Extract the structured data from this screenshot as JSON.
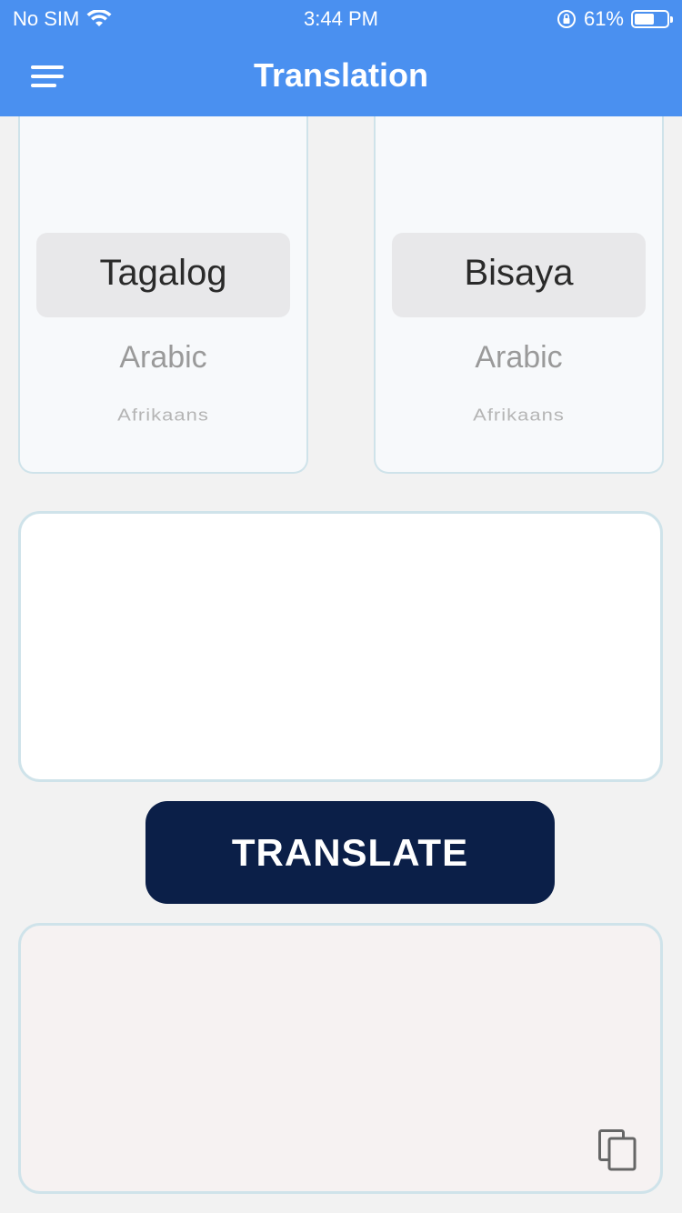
{
  "status_bar": {
    "carrier": "No SIM",
    "time": "3:44 PM",
    "battery_percent": "61%",
    "battery_level": 0.61
  },
  "nav": {
    "title": "Translation",
    "menu_icon": "hamburger-menu-icon"
  },
  "source_picker": {
    "selected": "Tagalog",
    "options_below": [
      "Arabic",
      "Afrikaans"
    ]
  },
  "target_picker": {
    "selected": "Bisaya",
    "options_below": [
      "Arabic",
      "Afrikaans"
    ]
  },
  "input": {
    "value": ""
  },
  "translate_button": {
    "label": "TRANSLATE"
  },
  "output": {
    "value": "",
    "copy_icon": "copy-icon"
  },
  "colors": {
    "header": "#4a90f0",
    "button": "#0b1f48",
    "border": "#cfe3ea"
  }
}
